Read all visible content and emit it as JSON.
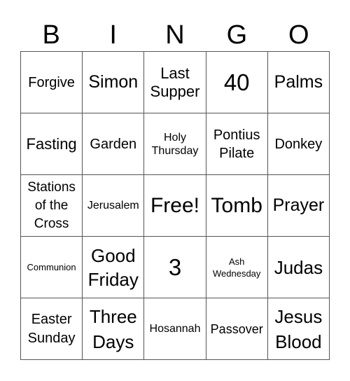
{
  "header": [
    "B",
    "I",
    "N",
    "G",
    "O"
  ],
  "cells": [
    "Forgive",
    "Simon",
    "Last Supper",
    "40",
    "Palms",
    "Fasting",
    "Garden",
    "Holy Thursday",
    "Pontius Pilate",
    "Donkey",
    "Stations of the Cross",
    "Jerusalem",
    "Free!",
    "Tomb",
    "Prayer",
    "Communion",
    "Good Friday",
    "3",
    "Ash Wednesday",
    "Judas",
    "Easter Sunday",
    "Three Days",
    "Hosannah",
    "Passover",
    "Jesus Blood"
  ]
}
